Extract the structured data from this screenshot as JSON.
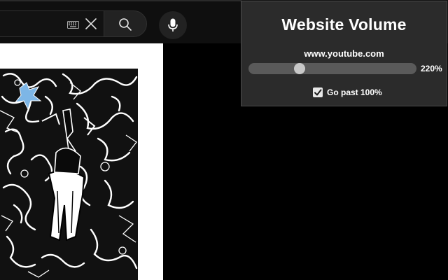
{
  "youtube_header": {
    "icons": {
      "keyboard": "keyboard-icon",
      "clear": "close-icon",
      "search": "search-icon",
      "mic": "microphone-icon"
    },
    "colors": {
      "header_bg": "#0f0f0f",
      "button_bg": "#222222",
      "border": "#303030"
    }
  },
  "video": {
    "thumbnail": "abstract black-and-white doodle artwork"
  },
  "popup": {
    "title": "Website Volume",
    "site": "www.youtube.com",
    "volume_display": "220%",
    "slider_fraction": 0.29,
    "checkbox": {
      "label": "Go past 100%",
      "checked": true
    },
    "colors": {
      "background": "#2b2b2b",
      "border": "#4a4a4a",
      "track": "#5a5a5a",
      "thumb": "#c8c8c8",
      "text": "#ffffff"
    }
  }
}
